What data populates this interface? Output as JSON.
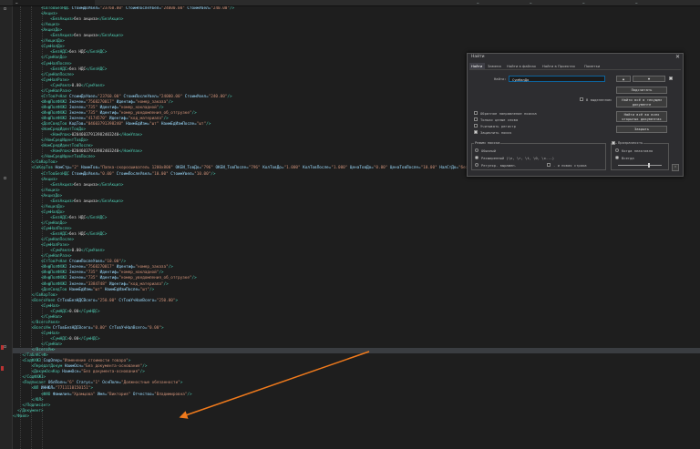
{
  "tabs": [
    {
      "label": "…"
    },
    {
      "label": "…"
    },
    {
      "label": "…"
    },
    {
      "label": "…"
    },
    {
      "label": "…"
    }
  ],
  "editor_lines": [
    {
      "indent": 12,
      "parts": [
        [
          "t",
          "<СвТовБезНДС "
        ],
        [
          "a",
          "СтоимДоУвел="
        ],
        [
          "v",
          "\"23760.00\""
        ],
        [
          "a",
          " СтоимПослеУвел="
        ],
        [
          "v",
          "\"24000.00\""
        ],
        [
          "a",
          " СтоимУвел="
        ],
        [
          "v",
          "\"240.00\""
        ],
        [
          "t",
          "/>"
        ]
      ]
    },
    {
      "indent": 12,
      "parts": [
        [
          "t",
          "<Акциз>"
        ]
      ]
    },
    {
      "indent": 16,
      "parts": [
        [
          "t",
          "<БезАкциз>"
        ],
        [
          "x",
          "без акциза"
        ],
        [
          "t",
          "</БезАкциз>"
        ]
      ]
    },
    {
      "indent": 12,
      "parts": [
        [
          "t",
          "</Акциз>"
        ]
      ]
    },
    {
      "indent": 12,
      "parts": [
        [
          "t",
          "<АкцизДо>"
        ]
      ]
    },
    {
      "indent": 16,
      "parts": [
        [
          "t",
          "<БезАкциз>"
        ],
        [
          "x",
          "без акциза"
        ],
        [
          "t",
          "</БезАкциз>"
        ]
      ]
    },
    {
      "indent": 12,
      "parts": [
        [
          "t",
          "</АкцизДо>"
        ]
      ]
    },
    {
      "indent": 12,
      "parts": [
        [
          "t",
          "<СумНалДо>"
        ]
      ]
    },
    {
      "indent": 16,
      "parts": [
        [
          "t",
          "<БезНДС>"
        ],
        [
          "x",
          "без НДС"
        ],
        [
          "t",
          "</БезНДС>"
        ]
      ]
    },
    {
      "indent": 12,
      "parts": [
        [
          "t",
          "</СумНалДо>"
        ]
      ]
    },
    {
      "indent": 12,
      "parts": [
        [
          "t",
          "<СумНалПосле>"
        ]
      ]
    },
    {
      "indent": 16,
      "parts": [
        [
          "t",
          "<БезНДС>"
        ],
        [
          "x",
          "без НДС"
        ],
        [
          "t",
          "</БезНДС>"
        ]
      ]
    },
    {
      "indent": 12,
      "parts": [
        [
          "t",
          "</СумНалПосле>"
        ]
      ]
    },
    {
      "indent": 12,
      "parts": [
        [
          "t",
          "<СумНалРазн>"
        ]
      ]
    },
    {
      "indent": 16,
      "parts": [
        [
          "t",
          "<СумУвел>"
        ],
        [
          "x",
          "0.00"
        ],
        [
          "t",
          "</СумУвел>"
        ]
      ]
    },
    {
      "indent": 12,
      "parts": [
        [
          "t",
          "</СумНалРазн>"
        ]
      ]
    },
    {
      "indent": 12,
      "parts": [
        [
          "t",
          "<СтТовУчНал "
        ],
        [
          "a",
          "СтоимДоУвел="
        ],
        [
          "v",
          "\"23760.00\""
        ],
        [
          "a",
          " СтоимПослеУвел="
        ],
        [
          "v",
          "\"24000.00\""
        ],
        [
          "a",
          " СтоимУвел="
        ],
        [
          "v",
          "\"240.00\""
        ],
        [
          "t",
          "/>"
        ]
      ]
    },
    {
      "indent": 12,
      "parts": [
        [
          "t",
          "<ИнфПолФХЖ2 "
        ],
        [
          "a",
          "Значен="
        ],
        [
          "v",
          "\"7568270017\""
        ],
        [
          "a",
          " Идентиф="
        ],
        [
          "v",
          "\"номер_заказа\""
        ],
        [
          "t",
          "/>"
        ]
      ]
    },
    {
      "indent": 12,
      "parts": [
        [
          "t",
          "<ИнфПолФХЖ2 "
        ],
        [
          "a",
          "Значен="
        ],
        [
          "v",
          "\"735\""
        ],
        [
          "a",
          " Идентиф="
        ],
        [
          "v",
          "\"номер_накладной\""
        ],
        [
          "t",
          "/>"
        ]
      ]
    },
    {
      "indent": 12,
      "parts": [
        [
          "t",
          "<ИнфПолФХЖ2 "
        ],
        [
          "a",
          "Значен="
        ],
        [
          "v",
          "\"735\""
        ],
        [
          "a",
          " Идентиф="
        ],
        [
          "v",
          "\"номер_уведомления_об_отгрузке\""
        ],
        [
          "t",
          "/>"
        ]
      ]
    },
    {
      "indent": 12,
      "parts": [
        [
          "t",
          "<ИнфПолФХЖ2 "
        ],
        [
          "a",
          "Значен="
        ],
        [
          "v",
          "\"4174570\""
        ],
        [
          "a",
          " Идентиф="
        ],
        [
          "v",
          "\"код_материала\""
        ],
        [
          "t",
          "/>"
        ]
      ]
    },
    {
      "indent": 12,
      "parts": [
        [
          "t",
          "<ДопСведТов "
        ],
        [
          "a",
          "КодТов="
        ],
        [
          "v",
          "\"04603791398240\""
        ],
        [
          "a",
          " НаимЕдИзм="
        ],
        [
          "v",
          "\"шт\""
        ],
        [
          "a",
          " НаимЕдИзмПосле="
        ],
        [
          "v",
          "\"шт\""
        ],
        [
          "t",
          "/>"
        ]
      ]
    },
    {
      "indent": 12,
      "parts": [
        [
          "t",
          "<НомСредИдентТовДо>"
        ]
      ]
    },
    {
      "indent": 16,
      "parts": [
        [
          "t",
          "<НомУпак>"
        ],
        [
          "x",
          "02046037913982403240"
        ],
        [
          "t",
          "</НомУпак>"
        ]
      ]
    },
    {
      "indent": 12,
      "parts": [
        [
          "t",
          "</НомСредИдентТовДо>"
        ]
      ]
    },
    {
      "indent": 12,
      "parts": [
        [
          "t",
          "<НомСредИдентТовПосле>"
        ]
      ]
    },
    {
      "indent": 16,
      "parts": [
        [
          "t",
          "<НомУпак>"
        ],
        [
          "x",
          "02046037913982403240"
        ],
        [
          "t",
          "</НомУпак>"
        ]
      ]
    },
    {
      "indent": 12,
      "parts": [
        [
          "t",
          "</НомСредИдентТовПосле>"
        ]
      ]
    },
    {
      "indent": 8,
      "parts": [
        [
          "t",
          "</СвКорТов>"
        ]
      ]
    },
    {
      "indent": 8,
      "parts": [
        [
          "t",
          "<СвКорТов "
        ],
        [
          "a",
          "НомСтр="
        ],
        [
          "v",
          "\"2\""
        ],
        [
          "a",
          " НаимТов="
        ],
        [
          "v",
          "\"Папка-скоросшиватель 1200x800\""
        ],
        [
          "a",
          " ОКЕИ_ТовДо="
        ],
        [
          "v",
          "\"796\""
        ],
        [
          "a",
          " ОКЕИ_ТовПосле="
        ],
        [
          "v",
          "\"796\""
        ],
        [
          "a",
          " КолТовДо="
        ],
        [
          "v",
          "\"1.000\""
        ],
        [
          "a",
          " КолТовПосле="
        ],
        [
          "v",
          "\"1.000\""
        ],
        [
          "a",
          " ЦенаТовДо="
        ],
        [
          "v",
          "\"0.00\""
        ],
        [
          "a",
          " ЦенаТовПосле="
        ],
        [
          "v",
          "\"10.00\""
        ],
        [
          "a",
          " НалСтДо="
        ],
        [
          "v",
          "\"без НДС\""
        ],
        [
          "a",
          " НалСтПосле="
        ],
        [
          "v",
          "\"без НДС\""
        ],
        [
          "t",
          ">"
        ]
      ]
    },
    {
      "indent": 12,
      "parts": [
        [
          "t",
          "<СтТовБезНДС "
        ],
        [
          "a",
          "СтоимДоУвел="
        ],
        [
          "v",
          "\"0.00\""
        ],
        [
          "a",
          " СтоимПослеУвел="
        ],
        [
          "v",
          "\"10.00\""
        ],
        [
          "a",
          " СтоимУвел="
        ],
        [
          "v",
          "\"10.00\""
        ],
        [
          "t",
          "/>"
        ]
      ]
    },
    {
      "indent": 12,
      "parts": [
        [
          "t",
          "<Акциз>"
        ]
      ]
    },
    {
      "indent": 16,
      "parts": [
        [
          "t",
          "<БезАкциз>"
        ],
        [
          "x",
          "без акциза"
        ],
        [
          "t",
          "</БезАкциз>"
        ]
      ]
    },
    {
      "indent": 12,
      "parts": [
        [
          "t",
          "</Акциз>"
        ]
      ]
    },
    {
      "indent": 12,
      "parts": [
        [
          "t",
          "<АкцизДо>"
        ]
      ]
    },
    {
      "indent": 16,
      "parts": [
        [
          "t",
          "<БезАкциз>"
        ],
        [
          "x",
          "без акциза"
        ],
        [
          "t",
          "</БезАкциз>"
        ]
      ]
    },
    {
      "indent": 12,
      "parts": [
        [
          "t",
          "</АкцизДо>"
        ]
      ]
    },
    {
      "indent": 12,
      "parts": [
        [
          "t",
          "<СумНалДо>"
        ]
      ]
    },
    {
      "indent": 16,
      "parts": [
        [
          "t",
          "<БезНДС>"
        ],
        [
          "x",
          "без НДС"
        ],
        [
          "t",
          "</БезНДС>"
        ]
      ]
    },
    {
      "indent": 12,
      "parts": [
        [
          "t",
          "</СумНалДо>"
        ]
      ]
    },
    {
      "indent": 12,
      "parts": [
        [
          "t",
          "<СумНалПосле>"
        ]
      ]
    },
    {
      "indent": 16,
      "parts": [
        [
          "t",
          "<БезНДС>"
        ],
        [
          "x",
          "без НДС"
        ],
        [
          "t",
          "</БезНДС>"
        ]
      ]
    },
    {
      "indent": 12,
      "parts": [
        [
          "t",
          "</СумНалПосле>"
        ]
      ]
    },
    {
      "indent": 12,
      "parts": [
        [
          "t",
          "<СумНалРазн>"
        ]
      ]
    },
    {
      "indent": 16,
      "parts": [
        [
          "t",
          "<СумУвел>"
        ],
        [
          "x",
          "0.00"
        ],
        [
          "t",
          "</СумУвел>"
        ]
      ]
    },
    {
      "indent": 12,
      "parts": [
        [
          "t",
          "</СумНалРазн>"
        ]
      ]
    },
    {
      "indent": 12,
      "parts": [
        [
          "t",
          "<СтТовУчНал "
        ],
        [
          "a",
          "СтоимПослеУвел="
        ],
        [
          "v",
          "\"10.00\""
        ],
        [
          "t",
          "/>"
        ]
      ]
    },
    {
      "indent": 12,
      "parts": [
        [
          "t",
          "<ИнфПолФХЖ2 "
        ],
        [
          "a",
          "Значен="
        ],
        [
          "v",
          "\"7568270017\""
        ],
        [
          "a",
          " Идентиф="
        ],
        [
          "v",
          "\"номер_заказа\""
        ],
        [
          "t",
          "/>"
        ]
      ]
    },
    {
      "indent": 12,
      "parts": [
        [
          "t",
          "<ИнфПолФХЖ2 "
        ],
        [
          "a",
          "Значен="
        ],
        [
          "v",
          "\"735\""
        ],
        [
          "a",
          " Идентиф="
        ],
        [
          "v",
          "\"номер_накладной\""
        ],
        [
          "t",
          "/>"
        ]
      ]
    },
    {
      "indent": 12,
      "parts": [
        [
          "t",
          "<ИнфПолФХЖ2 "
        ],
        [
          "a",
          "Значен="
        ],
        [
          "v",
          "\"735\""
        ],
        [
          "a",
          " Идентиф="
        ],
        [
          "v",
          "\"номер_уведомления_об_отгрузке\""
        ],
        [
          "t",
          "/>"
        ]
      ]
    },
    {
      "indent": 12,
      "parts": [
        [
          "t",
          "<ИнфПолФХЖ2 "
        ],
        [
          "a",
          "Значен="
        ],
        [
          "v",
          "\"3384748\""
        ],
        [
          "a",
          " Идентиф="
        ],
        [
          "v",
          "\"код_материала\""
        ],
        [
          "t",
          "/>"
        ]
      ]
    },
    {
      "indent": 12,
      "parts": [
        [
          "t",
          "<ДопСведТов "
        ],
        [
          "a",
          "НаимЕдИзм="
        ],
        [
          "v",
          "\"шт\""
        ],
        [
          "a",
          " НаимЕдИзмПосле="
        ],
        [
          "v",
          "\"шт\""
        ],
        [
          "t",
          "/>"
        ]
      ]
    },
    {
      "indent": 8,
      "parts": [
        [
          "t",
          "</СвКорТов>"
        ]
      ]
    },
    {
      "indent": 8,
      "parts": [
        [
          "t",
          "<ВсегоУвел "
        ],
        [
          "a",
          "СтТовБезНДСВсего="
        ],
        [
          "v",
          "\"250.00\""
        ],
        [
          "a",
          " СтТовУчНалВсего="
        ],
        [
          "v",
          "\"250.00\""
        ],
        [
          "t",
          ">"
        ]
      ]
    },
    {
      "indent": 12,
      "parts": [
        [
          "t",
          "<СумНал>"
        ]
      ]
    },
    {
      "indent": 16,
      "parts": [
        [
          "t",
          "<СумНДС>"
        ],
        [
          "x",
          "0.00"
        ],
        [
          "t",
          "</СумНДС>"
        ]
      ]
    },
    {
      "indent": 12,
      "parts": [
        [
          "t",
          "</СумНал>"
        ]
      ]
    },
    {
      "indent": 8,
      "parts": [
        [
          "t",
          "</ВсегоУвел>"
        ]
      ]
    },
    {
      "indent": 8,
      "parts": [
        [
          "t",
          "<ВсегоУм "
        ],
        [
          "a",
          "СтТовБезНДСВсего="
        ],
        [
          "v",
          "\"0.00\""
        ],
        [
          "a",
          " СтТовУчНалВсего="
        ],
        [
          "v",
          "\"0.00\""
        ],
        [
          "t",
          ">"
        ]
      ]
    },
    {
      "indent": 12,
      "parts": [
        [
          "t",
          "<СумНал>"
        ]
      ]
    },
    {
      "indent": 16,
      "parts": [
        [
          "t",
          "<СумНДС>"
        ],
        [
          "x",
          "0.00"
        ],
        [
          "t",
          "</СумНДС>"
        ]
      ]
    },
    {
      "indent": 12,
      "parts": [
        [
          "t",
          "</СумНал>"
        ]
      ]
    },
    {
      "indent": 8,
      "parts": [
        [
          "t",
          "</ВсегоУм>"
        ]
      ],
      "highlight": true
    },
    {
      "indent": 4,
      "parts": [
        [
          "t",
          "</ТаблКСчФ>"
        ]
      ]
    },
    {
      "indent": 4,
      "parts": [
        [
          "t",
          "<СодФХЖ3 "
        ],
        [
          "a",
          "СодОпер="
        ],
        [
          "v",
          "\"Изменение стоимости товара\""
        ],
        [
          "t",
          ">"
        ]
      ]
    },
    {
      "indent": 8,
      "parts": [
        [
          "t",
          "<ПередатДокум "
        ],
        [
          "a",
          "НаимОсн="
        ],
        [
          "v",
          "\"Без документа-основания\""
        ],
        [
          "t",
          "/>"
        ]
      ]
    },
    {
      "indent": 8,
      "parts": [
        [
          "t",
          "<ДокумОснКор "
        ],
        [
          "a",
          "НаимОсн="
        ],
        [
          "v",
          "\"Без документа-основания\""
        ],
        [
          "t",
          "/>"
        ]
      ]
    },
    {
      "indent": 4,
      "parts": [
        [
          "t",
          "</СодФХЖ3>"
        ]
      ]
    },
    {
      "indent": 4,
      "parts": [
        [
          "t",
          "<Подписант "
        ],
        [
          "a",
          "ОблПолн="
        ],
        [
          "v",
          "\"6\""
        ],
        [
          "a",
          " Статус="
        ],
        [
          "v",
          "\"1\""
        ],
        [
          "a",
          " ОснПолн="
        ],
        [
          "v",
          "\"Должностные обязанности\""
        ],
        [
          "t",
          ">"
        ]
      ]
    },
    {
      "indent": 8,
      "parts": [
        [
          "t",
          "<ЮЛ "
        ],
        [
          "a",
          "ИННЮЛ="
        ],
        [
          "v",
          "\"7711110150151\""
        ],
        [
          "t",
          ">"
        ]
      ]
    },
    {
      "indent": 12,
      "parts": [
        [
          "t",
          "<ФИО "
        ],
        [
          "a",
          "Фамилия="
        ],
        [
          "v",
          "\"Храмцова\""
        ],
        [
          "a",
          " Имя="
        ],
        [
          "v",
          "\"Виктория\""
        ],
        [
          "a",
          " Отчество="
        ],
        [
          "v",
          "\"Владимировна\""
        ],
        [
          "t",
          "/>"
        ]
      ]
    },
    {
      "indent": 8,
      "parts": [
        [
          "t",
          "</ЮЛ>"
        ]
      ]
    },
    {
      "indent": 4,
      "parts": [
        [
          "t",
          "</Подписант>"
        ]
      ]
    },
    {
      "indent": 2,
      "parts": [
        [
          "t",
          "</Документ>"
        ]
      ]
    },
    {
      "indent": 0,
      "parts": [
        [
          "t",
          "</Файл>"
        ]
      ]
    }
  ],
  "find_dialog": {
    "title": "Найти",
    "close": "✕",
    "tabs": [
      "Найти",
      "Замена",
      "Найти в файлах",
      "Найти в Проектах",
      "Пометки"
    ],
    "find_label": "Найти:",
    "find_value": "СумНалДо",
    "buttons": {
      "prev": "▲",
      "next": "▼",
      "count": "Подсчитать",
      "find_all_current": "Найти всё в текущем документе",
      "find_all_open": "Найти всё во всех открытых документах",
      "close": "Закрыть"
    },
    "in_selection": "В выделенном",
    "options": [
      "Обратное направление поиска",
      "Только целые слова",
      "Учитывать регистр",
      "Зациклить поиск"
    ],
    "search_mode_title": "Режим поиска",
    "modes": [
      "Обычный",
      "Расширенный (\\n, \\r, \\t, \\0, \\x...)",
      "Регуляр. выражен."
    ],
    "dot_newline": ". и новая строка",
    "transparency_title": "Прозрачность",
    "transparency_opts": [
      "Когда неактивно",
      "Всегда"
    ],
    "transparency_level": 0.7
  },
  "colors": {
    "accent": "#0e639c",
    "arrow": "#f07a1c"
  }
}
